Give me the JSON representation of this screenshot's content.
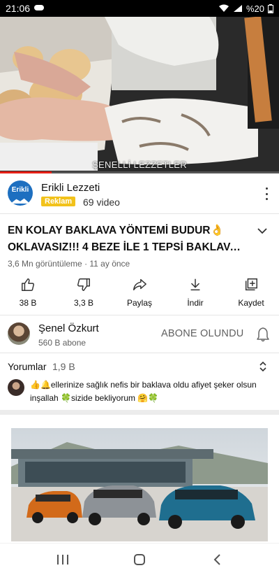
{
  "status_bar": {
    "time": "21:06",
    "battery": "%20"
  },
  "video": {
    "watermark": "ŞENELLİ LEZZETLER",
    "progress_fraction": 0.185
  },
  "ad_channel": {
    "logo_text": "Erikli",
    "name": "Erikli Lezzeti",
    "badge": "Reklam",
    "video_count": "69 video"
  },
  "video_info": {
    "title_line1": "EN KOLAY BAKLAVA YÖNTEMİ BUDUR👌",
    "title_line2": "OKLAVASIZ!!! 4 BEZE İLE 1 TEPSİ BAKLAVA Y...",
    "meta": "3,6 Mn görüntüleme · 11 ay önce"
  },
  "actions": [
    {
      "icon": "thumb-up-icon",
      "label": "38 B"
    },
    {
      "icon": "thumb-down-icon",
      "label": "3,3 B"
    },
    {
      "icon": "share-icon",
      "label": "Paylaş"
    },
    {
      "icon": "download-icon",
      "label": "İndir"
    },
    {
      "icon": "save-playlist-icon",
      "label": "Kaydet"
    }
  ],
  "channel": {
    "name": "Şenel Özkurt",
    "subscribers": "560 B abone",
    "subscribe_label": "ABONE OLUNDU"
  },
  "comments": {
    "heading": "Yorumlar",
    "count": "1,9 B",
    "top_comment": "👍🔔ellerinize sağlık nefis bir baklava oldu afiyet şeker olsun inşallah 🍀sizide bekliyorum 🤗🍀"
  },
  "colors": {
    "accent": "#e62117",
    "badge": "#f2c21b",
    "secondary_text": "#606060"
  }
}
